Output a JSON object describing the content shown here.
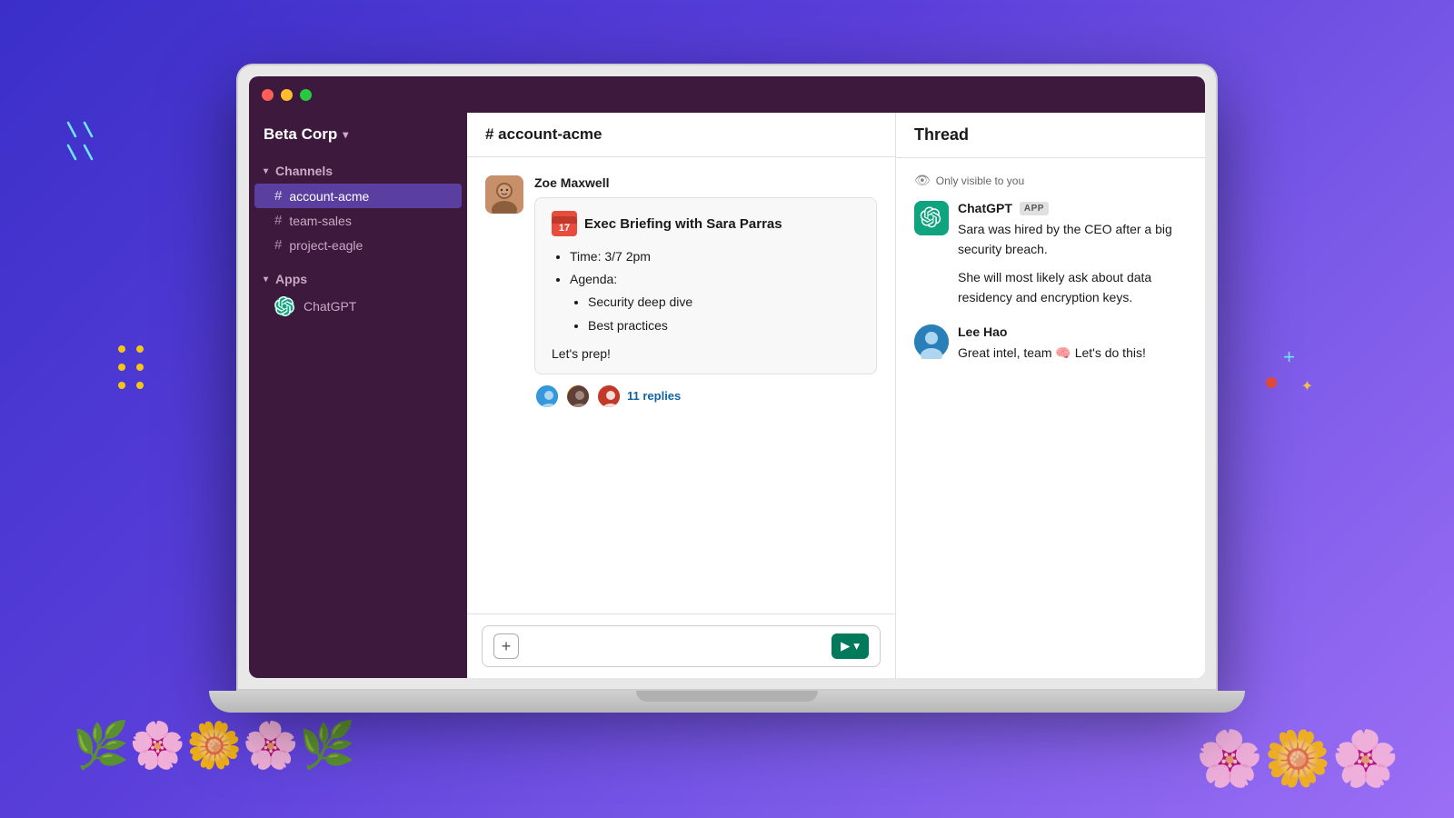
{
  "workspace": {
    "name": "Beta Corp",
    "chevron": "▾"
  },
  "sidebar": {
    "channels_label": "Channels",
    "channels": [
      {
        "name": "account-acme",
        "active": true
      },
      {
        "name": "team-sales",
        "active": false
      },
      {
        "name": "project-eagle",
        "active": false
      }
    ],
    "apps_label": "Apps",
    "apps": [
      {
        "name": "ChatGPT"
      }
    ]
  },
  "channel": {
    "name": "# account-acme",
    "message": {
      "sender": "Zoe Maxwell",
      "calendar_day": "17",
      "title": "Exec Briefing with Sara Parras",
      "time_label": "Time: 3/7 2pm",
      "agenda_label": "Agenda:",
      "agenda_items": [
        "Security deep dive",
        "Best practices"
      ],
      "lets_prep": "Let's prep!",
      "replies_count": "11 replies"
    },
    "input_placeholder": ""
  },
  "thread": {
    "title": "Thread",
    "visibility_notice": "Only visible to you",
    "chatgpt_message": {
      "sender": "ChatGPT",
      "badge": "APP",
      "text_1": "Sara was hired by the CEO after a big security breach.",
      "text_2": "She will most likely ask about data residency and encryption keys."
    },
    "lee_message": {
      "sender": "Lee Hao",
      "text": "Great intel, team 🧠 Let's do this!"
    }
  },
  "icons": {
    "hash": "#",
    "triangle_down": "▾",
    "eye": "👁",
    "plus": "+",
    "send": "▶"
  }
}
